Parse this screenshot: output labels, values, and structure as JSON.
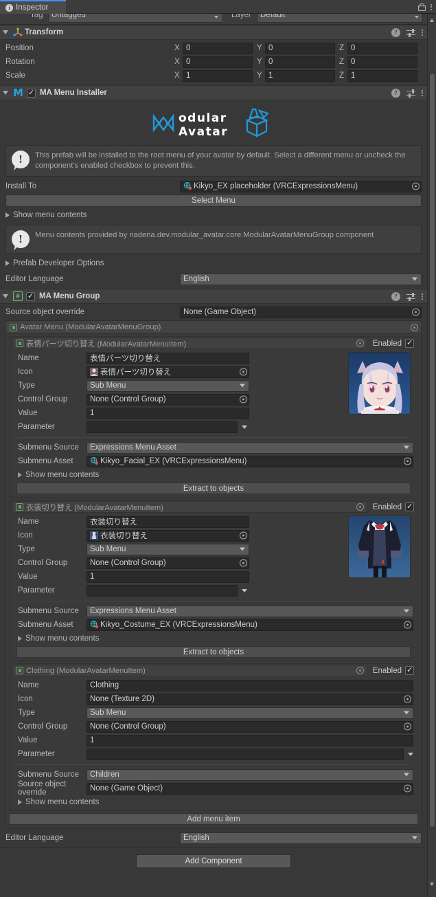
{
  "window": {
    "tab_label": "Inspector",
    "tab_icon": "info-icon",
    "lock_icon": "lock-icon",
    "menu_icon": "kebab-menu-icon"
  },
  "tag_layer": {
    "tag_label": "Tag",
    "tag_value": "Untagged",
    "layer_label": "Layer",
    "layer_value": "Default"
  },
  "transform": {
    "title": "Transform",
    "icon": "transform-axis-icon",
    "rows": [
      {
        "label": "Position",
        "x": "0",
        "y": "0",
        "z": "0"
      },
      {
        "label": "Rotation",
        "x": "0",
        "y": "0",
        "z": "0"
      },
      {
        "label": "Scale",
        "x": "1",
        "y": "1",
        "z": "1"
      }
    ],
    "axis_labels": {
      "x": "X",
      "y": "Y",
      "z": "Z"
    }
  },
  "menu_installer": {
    "title": "MA Menu Installer",
    "logo_text_top": "odular",
    "logo_text_bottom": "Avatar",
    "help_text": "This prefab will be installed to the root menu of your avatar by default. Select a different menu or uncheck the component's enabled checkbox to prevent this.",
    "install_to_label": "Install To",
    "install_to_value": "Kikyo_EX placeholder (VRCExpressionsMenu)",
    "select_menu_button": "Select Menu",
    "show_menu_contents": "Show menu contents",
    "menu_contents_note": "Menu contents provided by nadena.dev.modular_avatar.core.ModularAvatarMenuGroup component",
    "prefab_developer_options": "Prefab Developer Options",
    "editor_language_label": "Editor Language",
    "editor_language_value": "English"
  },
  "menu_group": {
    "title": "MA Menu Group",
    "source_object_override_label": "Source object override",
    "source_object_override_value": "None (Game Object)",
    "group_header": "Avatar Menu (ModularAvatarMenuGroup)",
    "enabled_label": "Enabled",
    "add_menu_item_button": "Add menu item",
    "editor_language_label": "Editor Language",
    "editor_language_value": "English",
    "labels": {
      "name": "Name",
      "icon": "Icon",
      "type": "Type",
      "control_group": "Control Group",
      "value": "Value",
      "parameter": "Parameter",
      "submenu_source": "Submenu Source",
      "submenu_asset": "Submenu Asset",
      "source_object_override": "Source object override",
      "show_menu_contents": "Show menu contents",
      "extract_to_objects": "Extract to objects"
    },
    "items": [
      {
        "header": "表情パーツ切り替え (ModularAvatarMenuItem)",
        "enabled": true,
        "name": "表情パーツ切り替え",
        "icon": "表情パーツ切り替え",
        "icon_is_none": false,
        "type": "Sub Menu",
        "control_group": "None (Control Group)",
        "value": "1",
        "parameter": "",
        "submenu_source": "Expressions Menu Asset",
        "submenu_asset": "Kikyo_Facial_EX (VRCExpressionsMenu)",
        "thumbnail": "avatar-face-thumbnail"
      },
      {
        "header": "衣装切り替え (ModularAvatarMenuItem)",
        "enabled": true,
        "name": "衣装切り替え",
        "icon": "衣装切り替え",
        "icon_is_none": false,
        "type": "Sub Menu",
        "control_group": "None (Control Group)",
        "value": "1",
        "parameter": "",
        "submenu_source": "Expressions Menu Asset",
        "submenu_asset": "Kikyo_Costume_EX (VRCExpressionsMenu)",
        "thumbnail": "costume-thumbnail"
      },
      {
        "header": "Clothing (ModularAvatarMenuItem)",
        "enabled": true,
        "name": "Clothing",
        "icon": "None (Texture 2D)",
        "icon_is_none": true,
        "type": "Sub Menu",
        "control_group": "None (Control Group)",
        "value": "1",
        "parameter": "",
        "submenu_source": "Children",
        "source_object_override": "None (Game Object)",
        "thumbnail": null
      }
    ]
  },
  "footer": {
    "add_component_button": "Add Component"
  },
  "colors": {
    "accent_blue": "#4a8ff7",
    "logo_blue": "#2a9fe0",
    "panel_bg": "#383838",
    "header_bg": "#414141",
    "field_bg": "#2a2a2a"
  }
}
